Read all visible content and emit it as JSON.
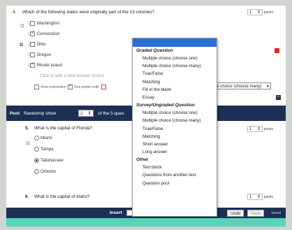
{
  "q4": {
    "number": "4.",
    "text": "Which of the following states were originally part of the 13 colonies?",
    "points_value": "1",
    "points_label": "points",
    "options": [
      {
        "label": "Washington",
        "checked": false
      },
      {
        "label": "Connecticut",
        "checked": true
      },
      {
        "label": "Ohio",
        "checked": false
      },
      {
        "label": "Oregon",
        "checked": false
      },
      {
        "label": "Rhode Island",
        "checked": true
      }
    ],
    "add_answer": "Click to add a new answer choice",
    "show_explanation": "Show explanation",
    "give_partial": "Give partial credit",
    "type_select": "le choice (choose many)"
  },
  "pool": {
    "label": "Pool",
    "randomly_show": "Randomly show",
    "count": "2",
    "of_text": "of the 5 ques"
  },
  "q5": {
    "number": "5.",
    "text": "What is the capital of Florida?",
    "points_value": "1",
    "points_label": "points",
    "options": [
      {
        "label": "Miami",
        "selected": false
      },
      {
        "label": "Tampa",
        "selected": false
      },
      {
        "label": "Tallahassee",
        "selected": true
      },
      {
        "label": "Orlando",
        "selected": false
      }
    ]
  },
  "q6": {
    "number": "6.",
    "text": "What is the capital of Idaho?",
    "points_value": "1",
    "points_label": "points"
  },
  "menu": {
    "groups": [
      {
        "title": "Graded Question",
        "items": [
          "Multiple choice (choose one)",
          "Multiple choice (choose many)",
          "True/False",
          "Matching",
          "Fill in the blank",
          "Essay"
        ]
      },
      {
        "title": "Survey/Ungraded Question",
        "items": [
          "Multiple choice (choose one)",
          "Multiple choice (choose many)",
          "True/False",
          "Matching",
          "Short answer",
          "Long answer"
        ]
      },
      {
        "title": "Other",
        "items": [
          "Text block",
          "Questions from another test",
          "Question pool"
        ]
      }
    ]
  },
  "bottom": {
    "insert": "Insert",
    "undo": "Undo",
    "redo": "Redo",
    "saved": "Saved"
  },
  "colors": {
    "navy": "#1d2f55",
    "highlight": "#2b6fd6",
    "teal": "#56d3b8"
  }
}
